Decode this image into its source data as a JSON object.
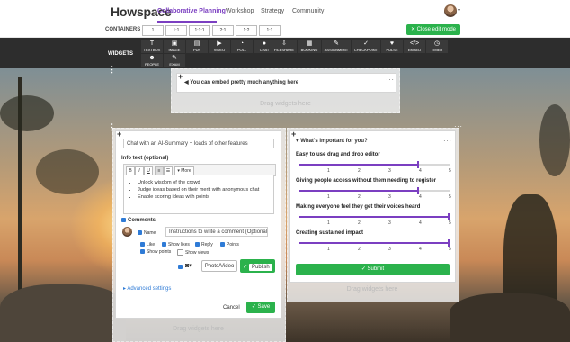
{
  "nav": {
    "logo": "Howspace",
    "links": [
      "Collaborative Planning",
      "Workshop",
      "Strategy",
      "Community"
    ]
  },
  "containers": {
    "label": "CONTAINERS",
    "items": [
      "1",
      "1:1",
      "1:1:1",
      "2:1",
      "1:2",
      "1:1"
    ],
    "close_edit": "✕ Close edit mode"
  },
  "widgets": {
    "label": "WIDGETS",
    "items": [
      {
        "label": "TEXTBOX",
        "icon": "T"
      },
      {
        "label": "IMAGE",
        "icon": "▣"
      },
      {
        "label": "PDF",
        "icon": "▤"
      },
      {
        "label": "VIDEO",
        "icon": "▶"
      },
      {
        "label": "POLL",
        "icon": "◔"
      },
      {
        "label": "CHAT",
        "icon": "●"
      },
      {
        "label": "FILESHARE",
        "icon": "⇩"
      },
      {
        "label": "BOOKING",
        "icon": "▦"
      },
      {
        "label": "ASSIGNMENT",
        "icon": "✎"
      },
      {
        "label": "CHECKPOINT",
        "icon": "✓"
      },
      {
        "label": "PULSE",
        "icon": "♥"
      },
      {
        "label": "EMBED",
        "icon": "</>"
      },
      {
        "label": "TIMER",
        "icon": "◷"
      }
    ],
    "row2": [
      {
        "label": "PEOPLE",
        "icon": "☻"
      },
      {
        "label": "EXAM",
        "icon": "✎"
      }
    ]
  },
  "embed": {
    "text": "You can embed pretty much anything here",
    "drag": "Drag widgets here"
  },
  "left_panel": {
    "title_value": "Chat with an AI-Summary + loads of other features",
    "info_label": "Info text (optional)",
    "toolbar": [
      "B",
      "I",
      "U",
      "≡",
      "☰",
      "▾ More"
    ],
    "bullets": [
      "Unlock wisdom of the crowd",
      "Judge ideas based on their merit with anonymous chat",
      "Enable scoring ideas with points"
    ],
    "comments_label": "Comments",
    "comment_placeholder": "Instructions to write a comment (Optional)",
    "options": [
      "Name",
      "Like",
      "Show likes",
      "Reply",
      "Points",
      "Show points",
      "Show views"
    ],
    "photo_video": "Photo/Video",
    "publish": "Publish",
    "advanced": "▸ Advanced settings",
    "cancel": "Cancel",
    "save": "✓ Save",
    "drag": "Drag widgets here"
  },
  "survey": {
    "title": "What's important for you?",
    "questions": [
      {
        "text": "Easy to use drag and drop editor",
        "value": 4
      },
      {
        "text": "Giving people access without them needing to register",
        "value": 4
      },
      {
        "text": "Making everyone feel they get their voices heard",
        "value": 5
      },
      {
        "text": "Creating sustained impact",
        "value": 5
      }
    ],
    "scale": [
      "1",
      "2",
      "3",
      "4",
      "5"
    ],
    "submit": "✓ Submit",
    "drag": "Drag widgets here"
  },
  "colors": {
    "accent": "#7b3fc1",
    "green": "#2bb24c",
    "dark_bar": "#2d2d2d"
  }
}
